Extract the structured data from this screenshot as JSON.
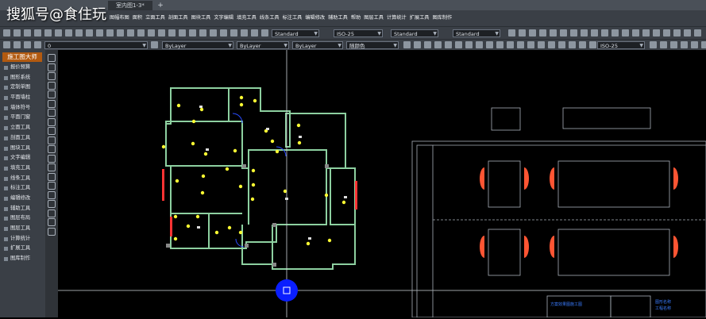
{
  "watermark": "搜狐号@食住玩",
  "titlebar": {
    "tab_label": "室内图1-3*",
    "add_tab": "+"
  },
  "menu": [
    "图幅布图",
    "面积",
    "立面工具",
    "剖面工具",
    "图块工具",
    "文字编辑",
    "填充工具",
    "线条工具",
    "标注工具",
    "编辑修改",
    "辅助工具",
    "帮助",
    "图层工具",
    "计算统计",
    "扩展工具",
    "图库制作"
  ],
  "toolbar2": {
    "layer": "0",
    "color": "ByLayer",
    "linetype": "ByLayer",
    "lineweight": "ByLayer",
    "plotstyle": "随颜色",
    "dimstyle": "ISO-25"
  },
  "toolbar1": {
    "textstyle": "Standard",
    "dimstyle": "ISO-25",
    "tablestyle": "Standard",
    "multileader": "Standard"
  },
  "sidebar": {
    "title": "施工图大师",
    "items": [
      "报价预算",
      "图形系统",
      "定制单图",
      "平面墙柱",
      "墙体符号",
      "平面门窗",
      "立面工具",
      "剖面工具",
      "图块工具",
      "文字编辑",
      "填充工具",
      "线条工具",
      "标注工具",
      "编辑修改",
      "辅助工具",
      "图层布局",
      "图层工具",
      "计算统计",
      "扩展工具",
      "图库制作"
    ]
  },
  "drawing": {
    "title_block_1": "图形名称",
    "title_block_2": "工程名称",
    "panel_caption": "方案效果图施工图"
  },
  "colors": {
    "wall": "#8dd0a0",
    "light": "#ffff33",
    "door": "#ff3333",
    "cursor": "#0a1eff"
  }
}
